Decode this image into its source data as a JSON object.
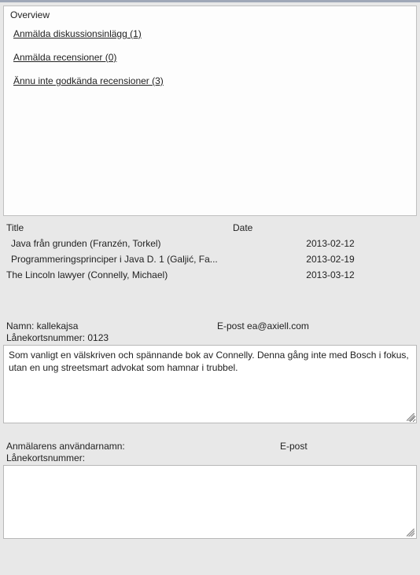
{
  "overview": {
    "title": "Overview",
    "links": [
      "Anmälda diskussionsinlägg (1)",
      "Anmälda recensioner (0)",
      "Ännu inte godkända recensioner (3)"
    ]
  },
  "table": {
    "headers": {
      "title": "Title",
      "date": "Date"
    },
    "rows": [
      {
        "title": "Java från grunden (Franzén, Torkel)",
        "date": "2013-02-12"
      },
      {
        "title": "Programmeringsprinciper i Java D. 1 (Galjić, Fa...",
        "date": "2013-02-19"
      },
      {
        "title": "The Lincoln lawyer (Connelly, Michael)",
        "date": "2013-03-12"
      }
    ]
  },
  "user": {
    "name_label": "Namn: kallekajsa",
    "email_label": "E-post ea@axiell.com",
    "card_label": "Lånekortsnummer: 0123",
    "review_text": "Som vanligt en välskriven och spännande bok av Connelly. Denna gång inte med Bosch i fokus, utan en ung streetsmart advokat som hamnar i trubbel."
  },
  "reporter": {
    "username_label": "Anmälarens användarnamn:",
    "email_label": "E-post",
    "card_label": "Lånekortsnummer:",
    "text": ""
  }
}
